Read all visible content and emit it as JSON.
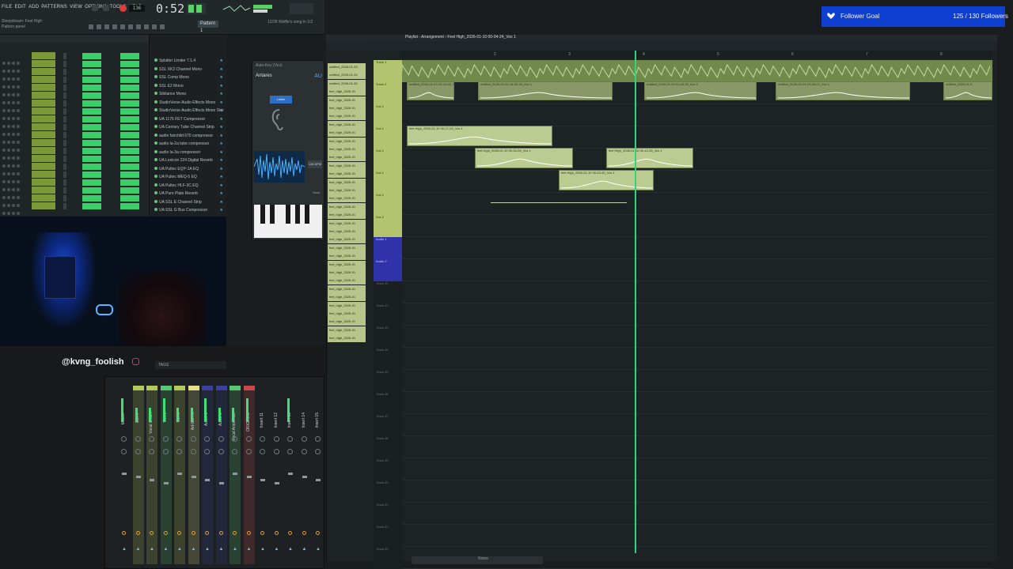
{
  "menu": [
    "FILE",
    "EDIT",
    "ADD",
    "PATTERNS",
    "VIEW",
    "OPTIONS",
    "TOOLS",
    "HELP"
  ],
  "hint_line1": "Sleepdream: Feel High",
  "hint_line2": "Pattern panel",
  "hint_right": "12/28 Waffle's song in 1/2",
  "timer": "0:52:85",
  "bpm": "136",
  "pattern_selector": "Pattern 1",
  "browser": {
    "items": [
      "Splatter Limiter 7.1.4",
      "SSL XK2 Channel Mono",
      "SSL Comp Mono",
      "SSL E2 Mono",
      "Sibilance Mono",
      "StudioVerse Audio Effects Mono",
      "StudioVerse Audio Effects Mono Stereo",
      "UA 1176 FET Compressor",
      "UA Century Tube Channel Strip",
      "audio fairchild 670 compressor",
      "audio la-2a tube compressor",
      "audio la-3a compressor",
      "UA Lexicon 224 Digital Reverb",
      "UA Pultec EQP-1A EQ",
      "UA Pultec MEQ-5 EQ",
      "UA Pultec HLF-3C EQ",
      "UA Pure Plate Reverb",
      "UA SSL E Channel Strip",
      "UA SSL G Bus Compressor"
    ],
    "search_label": "TAGS"
  },
  "plugin": {
    "window_title": "Auto-Key (Vox)",
    "name": "Antares",
    "badge": "AU",
    "button": "Listen",
    "status_chip": "136 BPM",
    "send": "Send"
  },
  "webcam": {
    "handle": "@kvng_foolish"
  },
  "mixer": {
    "strips": [
      {
        "label": "Master",
        "color": ""
      },
      {
        "label": "BEAT",
        "color": "#b3c95b"
      },
      {
        "label": "Vocal Chain",
        "color": "#b3c95b"
      },
      {
        "label": "Vox 1",
        "color": "#58c770"
      },
      {
        "label": "Vox 2",
        "color": "#b3c95b"
      },
      {
        "label": "Ad-libs Fx",
        "color": "#e6df88"
      },
      {
        "label": "Audio 1",
        "color": "#3d3f9e"
      },
      {
        "label": "Audio 2",
        "color": "#3d3f9e"
      },
      {
        "label": "Vocal Ambience",
        "color": "#58c770"
      },
      {
        "label": "ORIGINAL",
        "color": "#c94949"
      },
      {
        "label": "Insert 11",
        "color": ""
      },
      {
        "label": "Insert 12",
        "color": ""
      },
      {
        "label": "Insert 13",
        "color": ""
      },
      {
        "label": "Insert 14",
        "color": ""
      },
      {
        "label": "Insert 15",
        "color": ""
      }
    ],
    "top_numbers": [
      "1",
      "2",
      "3",
      "4",
      "5",
      "6",
      "7",
      "8",
      "9",
      "10"
    ]
  },
  "patterns": [
    "untitled_2026-01-03",
    "untitled_2026-01-04",
    "untitled_2026-01-05",
    "feel_high_2026-01",
    "feel_high_2026-01",
    "feel_high_2026-01",
    "feel_high_2026-01",
    "feel_high_2026-01",
    "feel_high_2026-01",
    "feel_high_2026-01",
    "feel_high_2026-01",
    "feel_high_2026-01",
    "feel_high_2026-01",
    "feel_high_2026-01",
    "feel_high_2026-01",
    "feel_high_2026-01",
    "feel_high_2026-01",
    "feel_high_2026-01",
    "feel_high_2026-01",
    "feel_high_2026-01",
    "feel_high_2026-01",
    "feel_high_2026-01",
    "feel_high_2026-01",
    "feel_high_2026-01",
    "feel_high_2026-01",
    "feel_high_2026-01",
    "feel_high_2026-01",
    "feel_high_2026-01",
    "feel_high_2026-01",
    "feel_high_2026-01",
    "feel_high_2026-01",
    "feel_high_2026-01",
    "feel_high_2026-01",
    "feel_high_2026-01"
  ],
  "playlist": {
    "title": "Playlist - Arrangement",
    "song": "Feel High_2026-01-10 00-04-24_Vox 1",
    "ruler": [
      "2",
      "3",
      "4",
      "5",
      "6",
      "7",
      "8"
    ],
    "tracks": [
      "Track 1",
      "Track 2",
      "Vox 1",
      "Vox 1",
      "Vox 1",
      "Vox 1",
      "Vox 1",
      "Vox 2",
      "Audio 1",
      "Audio 2",
      "Track 11",
      "Track 12",
      "Track 13",
      "Track 14",
      "Track 15",
      "Track 16",
      "Track 17",
      "Track 18",
      "Track 19",
      "Track 20",
      "Track 21",
      "Track 22",
      "Track 23"
    ],
    "clips": [
      {
        "name": "untitled_2026-01-03 ...",
        "row": 0
      },
      {
        "name": "untitled_2026-01-03 15-49-38_Vox 1",
        "row": 1
      },
      {
        "name": "untitled_2026-01-03 16-05-18_Vox 1",
        "row": 1
      },
      {
        "name": "untitled_2026-01-03 21-05-15_Vox 1",
        "row": 1
      },
      {
        "name": "untitled_2026-01-03 23-06-02_Vox 1",
        "row": 1
      },
      {
        "name": "untitled_2026-01-0",
        "row": 1
      },
      {
        "name": "feel High_2026-01-10 00-27-22_Vox 1",
        "row": 3
      },
      {
        "name": "feel High_2026-01-10 00-34-28_Vox 1",
        "row": 4
      },
      {
        "name": "feel High_2026-01-10 00-42-28_Vox 1",
        "row": 4
      },
      {
        "name": "feel High_2026-01-10 00-43-40_Vox 1",
        "row": 5
      }
    ],
    "scroll_label": "Notes"
  },
  "follower_goal": {
    "label": "Follower Goal",
    "progress": "125 / 130 Followers"
  }
}
